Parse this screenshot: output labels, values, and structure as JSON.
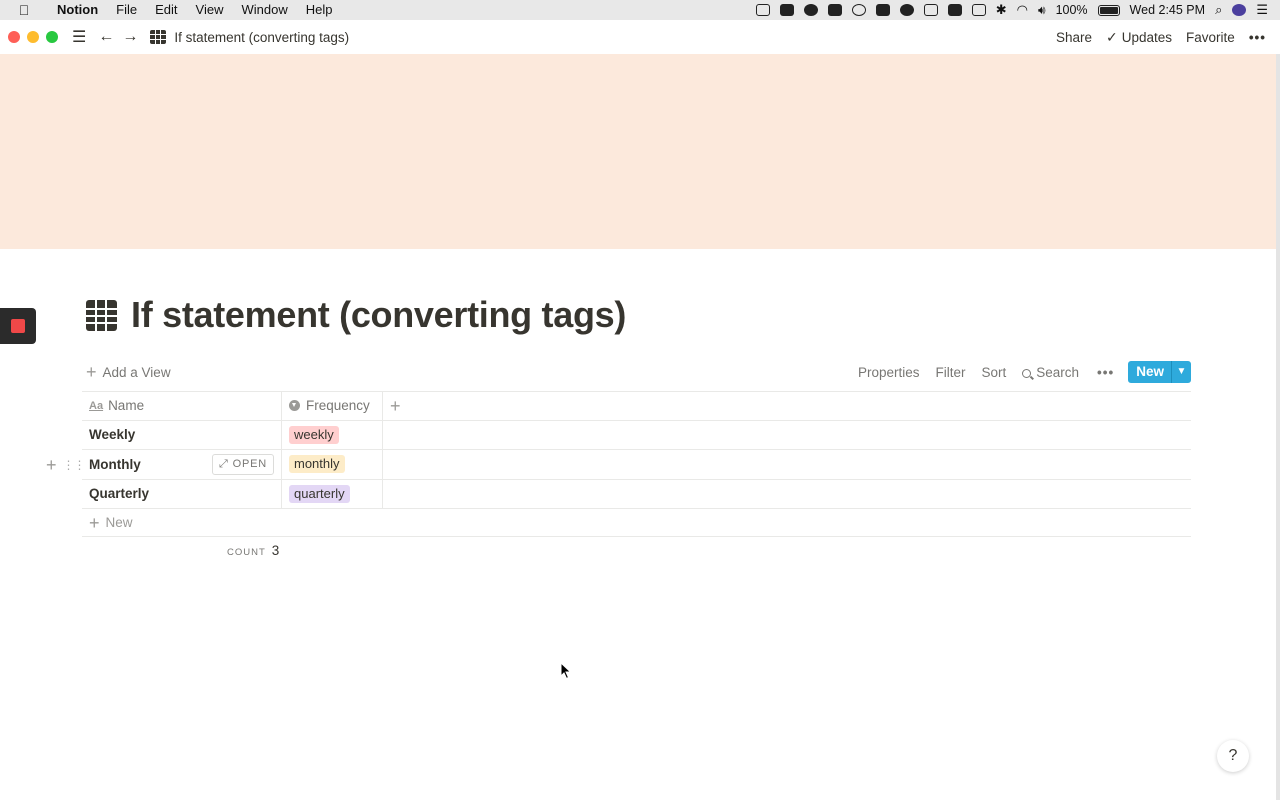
{
  "menubar": {
    "app_name": "Notion",
    "menus": [
      "File",
      "Edit",
      "View",
      "Window",
      "Help"
    ],
    "battery": "100%",
    "clock": "Wed 2:45 PM",
    "icons": [
      "calendar-icon",
      "video-icon",
      "sync-icon",
      "dropbox-icon",
      "info-icon",
      "bi-icon",
      "cloud-icon",
      "hand-icon",
      "quicktime-icon",
      "airplay-icon",
      "bluetooth-icon",
      "wifi-icon",
      "volume-icon",
      "battery-icon",
      "search-icon",
      "siri-icon",
      "list-icon"
    ]
  },
  "titlebar": {
    "title": "If statement (converting tags)",
    "share": "Share",
    "updates": "Updates",
    "favorite": "Favorite"
  },
  "page": {
    "title": "If statement (converting tags)",
    "cover_color": "#fce9dc"
  },
  "toolbar": {
    "add_view": "Add a View",
    "properties": "Properties",
    "filter": "Filter",
    "sort": "Sort",
    "search": "Search",
    "new": "New"
  },
  "table": {
    "columns": [
      {
        "label": "Name",
        "icon": "text-type-icon"
      },
      {
        "label": "Frequency",
        "icon": "select-type-icon"
      }
    ],
    "rows": [
      {
        "name": "Weekly",
        "frequency": "weekly",
        "tag_color": "#ffcfcf"
      },
      {
        "name": "Monthly",
        "frequency": "monthly",
        "tag_color": "#fdecc8",
        "open_label": "OPEN"
      },
      {
        "name": "Quarterly",
        "frequency": "quarterly",
        "tag_color": "#e3d7f5"
      }
    ],
    "new_row": "New",
    "count_label": "COUNT",
    "count_value": "3"
  },
  "help": "?"
}
